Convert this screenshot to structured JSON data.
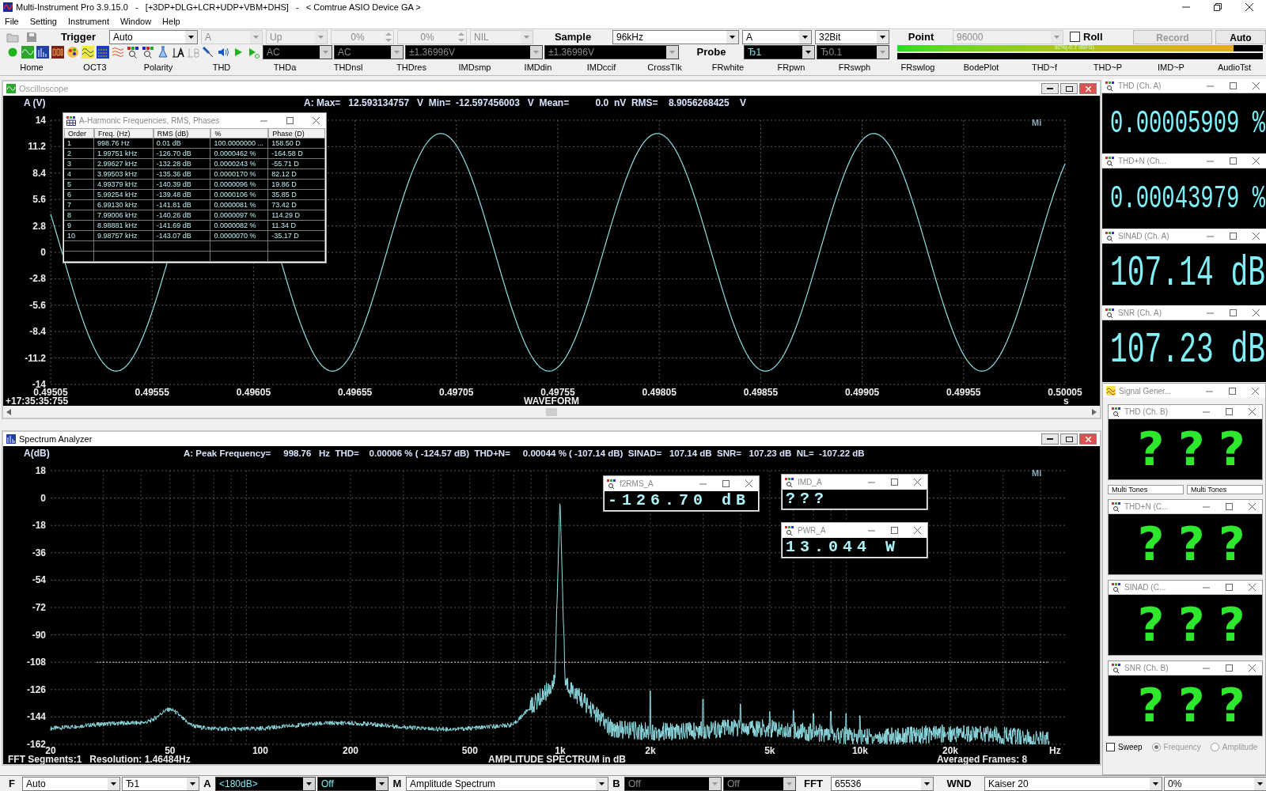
{
  "window": {
    "title": "Multi-Instrument Pro 3.9.15.0   -   [+3DP+DLG+LCR+UDP+VBM+DHS]   -   < Comtrue ASIO Device GA >"
  },
  "menu": [
    "File",
    "Setting",
    "Instrument",
    "Window",
    "Help"
  ],
  "toolbar_top": [
    {
      "kind": "label",
      "text": "Trigger"
    },
    {
      "kind": "combo",
      "value": "Auto",
      "disabled": false
    },
    {
      "kind": "combo",
      "value": "A",
      "disabled": true
    },
    {
      "kind": "combo",
      "value": "Up",
      "disabled": true
    },
    {
      "kind": "spinner",
      "value": "0%",
      "disabled": true
    },
    {
      "kind": "spinner",
      "value": "0%",
      "disabled": true
    },
    {
      "kind": "combo",
      "value": "NIL",
      "disabled": true
    },
    {
      "kind": "label",
      "text": "Sample"
    },
    {
      "kind": "combo",
      "value": "96kHz",
      "disabled": false
    },
    {
      "kind": "combo",
      "value": "A",
      "disabled": false
    },
    {
      "kind": "combo",
      "value": "32Bit",
      "disabled": false
    },
    {
      "kind": "label",
      "text": "Point"
    },
    {
      "kind": "combo",
      "value": "96000",
      "disabled": true
    },
    {
      "kind": "checkbox",
      "label": "Roll",
      "checked": false
    },
    {
      "kind": "button",
      "label": "Record",
      "disabled": true
    },
    {
      "kind": "button",
      "label": "Auto",
      "disabled": false
    }
  ],
  "toolbar_second": [
    {
      "kind": "dark_combo",
      "value": "AC",
      "disabled": true
    },
    {
      "kind": "dark_combo",
      "value": "AC",
      "disabled": true
    },
    {
      "kind": "dark_combo",
      "value": "±1.36996V",
      "disabled": true
    },
    {
      "kind": "dark_combo",
      "value": "±1.36996V",
      "disabled": true
    },
    {
      "kind": "label",
      "text": "Probe"
    },
    {
      "kind": "dark_combo",
      "value": "Ђ1",
      "disabled": false
    },
    {
      "kind": "dark_combo",
      "value": "Ђ0.1",
      "disabled": true
    }
  ],
  "channel_meters": [
    {
      "reading": "92%(-0.7 dBFS)",
      "level": 0.92
    }
  ],
  "tabs": [
    {
      "label": "Home",
      "selected": false
    },
    {
      "label": "OCT3",
      "selected": false
    },
    {
      "label": "Polarity",
      "selected": false
    },
    {
      "label": "THD",
      "selected": false
    },
    {
      "label": "THDa",
      "selected": false
    },
    {
      "label": "THDnsl",
      "selected": false
    },
    {
      "label": "THDres",
      "selected": false
    },
    {
      "label": "IMDsmp",
      "selected": false
    },
    {
      "label": "IMDdin",
      "selected": false
    },
    {
      "label": "IMDccif",
      "selected": false
    },
    {
      "label": "CrossTlk",
      "selected": false
    },
    {
      "label": "FRwhite",
      "selected": false
    },
    {
      "label": "FRpwn",
      "selected": false
    },
    {
      "label": "FRswph",
      "selected": false
    },
    {
      "label": "FRswlog",
      "selected": false
    },
    {
      "label": "BodePlot",
      "selected": false
    },
    {
      "label": "THD~f",
      "selected": false
    },
    {
      "label": "THD~P",
      "selected": false
    },
    {
      "label": "IMD~P",
      "selected": false
    },
    {
      "label": "AudioTst",
      "selected": false
    }
  ],
  "oscilloscope": {
    "title": "Oscilloscope",
    "y_label": "A (V)",
    "stats": "A: Max=   12.593134757   V  Min=  -12.597456003   V  Mean=          0.0  nV  RMS=    8.9056268425    V",
    "logo": "Mi",
    "y_ticks": [
      "14",
      "11.2",
      "8.4",
      "5.6",
      "2.8",
      "0",
      "-2.8",
      "-5.6",
      "-8.4",
      "-11.2",
      "-14"
    ],
    "x_ticks": [
      "0.49505",
      "0.49555",
      "0.49605",
      "0.49655",
      "0.49705",
      "0.49755",
      "0.49805",
      "0.49855",
      "0.49905",
      "0.49955",
      "0.50005"
    ],
    "timestamp": "+17:35:35:755",
    "x_title": "WAVEFORM",
    "x_unit": "s",
    "harmonics": {
      "title": "A-Harmonic Frequencies, RMS, Phases",
      "columns": [
        "Order",
        "Freq. (Hz)",
        "RMS (dB)",
        "%",
        "Phase (D)"
      ],
      "rows": [
        [
          "1",
          "998.76 Hz",
          "0.01 dB",
          "100.0000000 ...",
          "158.50 D"
        ],
        [
          "2",
          "1.99751 kHz",
          "-126.70 dB",
          "0.0000462 %",
          "-164.58 D"
        ],
        [
          "3",
          "2.99627 kHz",
          "-132.28 dB",
          "0.0000243 %",
          "-55.71 D"
        ],
        [
          "4",
          "3.99503 kHz",
          "-135.36 dB",
          "0.0000170 %",
          "82.12 D"
        ],
        [
          "5",
          "4.99379 kHz",
          "-140.39 dB",
          "0.0000096 %",
          "19.86 D"
        ],
        [
          "6",
          "5.99254 kHz",
          "-139.48 dB",
          "0.0000106 %",
          "35.85 D"
        ],
        [
          "7",
          "6.99130 kHz",
          "-141.81 dB",
          "0.0000081 %",
          "73.42 D"
        ],
        [
          "8",
          "7.99006 kHz",
          "-140.26 dB",
          "0.0000097 %",
          "114.29 D"
        ],
        [
          "9",
          "8.98881 kHz",
          "-141.69 dB",
          "0.0000082 %",
          "11.34 D"
        ],
        [
          "10",
          "9.98757 kHz",
          "-143.07 dB",
          "0.0000070 %",
          "-35.17 D"
        ]
      ]
    }
  },
  "spectrum": {
    "title": "Spectrum Analyzer",
    "y_label": "A(dB)",
    "stats": "A: Peak Frequency=     998.76   Hz  THD=    0.00006 % ( -124.57 dB)  THD+N=     0.00044 % ( -107.14 dB)  SINAD=   107.14 dB  SNR=   107.23 dB  NL=  -107.22 dB",
    "logo": "Mi",
    "y_ticks": [
      "18",
      "0",
      "-18",
      "-36",
      "-54",
      "-72",
      "-90",
      "-108",
      "-126",
      "-144",
      "-162"
    ],
    "x_ticks": [
      "20",
      "50",
      "100",
      "200",
      "500",
      "1k",
      "2k",
      "5k",
      "10k",
      "20k"
    ],
    "x_unit": "Hz",
    "x_title": "AMPLITUDE SPECTRUM in dB",
    "footer_left": "FFT Segments:1   Resolution: 1.46484Hz",
    "footer_right": "Averaged Frames: 8",
    "readouts": [
      {
        "title": "f2RMS_A",
        "value": "-126.70 dB"
      },
      {
        "title": "IMD_A",
        "value": "???"
      },
      {
        "title": "PWR_A",
        "value": "13.044 W"
      }
    ]
  },
  "readouts": [
    {
      "kind": "reading",
      "title": "THD (Ch. A)",
      "value": "0.00005909 %"
    },
    {
      "kind": "reading",
      "title": "THD+N (Ch...",
      "value": "0.00043979 %"
    },
    {
      "kind": "reading",
      "title": "SINAD (Ch. A)",
      "value": "107.14 dB"
    },
    {
      "kind": "reading",
      "title": "SNR (Ch. A)",
      "value": "107.23 dB"
    }
  ],
  "signal_generator": {
    "title": "Signal Gener...",
    "readouts": [
      {
        "kind": "unknown",
        "title": "THD (Ch. B)",
        "value": "???"
      },
      {
        "kind": "unknown",
        "title": "THD+N (C...",
        "value": "???"
      },
      {
        "kind": "unknown",
        "title": "SINAD (C...",
        "value": "???"
      },
      {
        "kind": "unknown",
        "title": "SNR (Ch. B)",
        "value": "???"
      }
    ],
    "dropdowns": [
      "Multi Tones",
      "Multi Tones"
    ],
    "options": [
      {
        "kind": "checkbox",
        "label": "Sweep",
        "checked": false,
        "disabled": false
      },
      {
        "kind": "radio",
        "label": "Frequency",
        "selected": true,
        "disabled": true
      },
      {
        "kind": "radio",
        "label": "Amplitude",
        "selected": false,
        "disabled": true
      }
    ]
  },
  "bottom_bar": [
    {
      "kind": "label",
      "text": "F"
    },
    {
      "kind": "combo",
      "value": "Auto",
      "disabled": false
    },
    {
      "kind": "combo",
      "value": "Ђ1",
      "disabled": false
    },
    {
      "kind": "label",
      "text": "A"
    },
    {
      "kind": "dark_combo",
      "value": "<180dB>",
      "disabled": false
    },
    {
      "kind": "dark_combo",
      "value": "Off",
      "disabled": false
    },
    {
      "kind": "label",
      "text": "M"
    },
    {
      "kind": "combo",
      "value": "Amplitude Spectrum",
      "disabled": false
    },
    {
      "kind": "label",
      "text": "B"
    },
    {
      "kind": "dark_combo",
      "value": "Off",
      "disabled": true
    },
    {
      "kind": "dark_combo",
      "value": "Off",
      "disabled": true
    },
    {
      "kind": "label",
      "text": "FFT"
    },
    {
      "kind": "combo",
      "value": "65536",
      "disabled": false
    },
    {
      "kind": "label",
      "text": "WND"
    },
    {
      "kind": "combo",
      "value": "Kaiser 20",
      "disabled": false
    },
    {
      "kind": "combo",
      "value": "0%",
      "disabled": false
    }
  ]
}
